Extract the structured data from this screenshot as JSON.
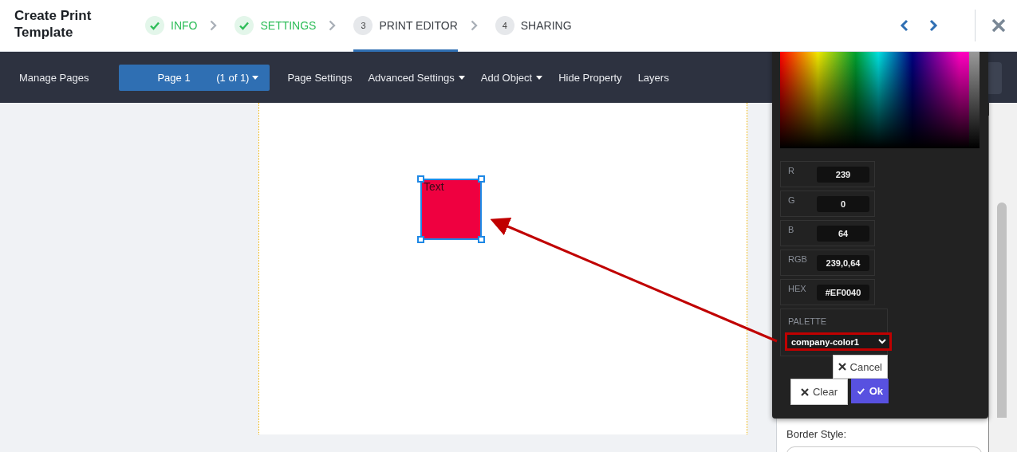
{
  "title": "Create Print Template",
  "steps": [
    {
      "label": "INFO",
      "done": true,
      "selected": false
    },
    {
      "label": "SETTINGS",
      "done": true,
      "selected": false
    },
    {
      "label": "PRINT EDITOR",
      "number": "3",
      "done": false,
      "selected": true
    },
    {
      "label": "SHARING",
      "number": "4",
      "done": false,
      "selected": false
    }
  ],
  "toolbar": {
    "manage_pages": "Manage Pages",
    "page_select": {
      "label": "Page 1",
      "count": "(1 of 1)"
    },
    "items": [
      {
        "label": "Page Settings",
        "dropdown": false
      },
      {
        "label": "Advanced Settings",
        "dropdown": true
      },
      {
        "label": "Add Object",
        "dropdown": true
      },
      {
        "label": "Hide Property",
        "dropdown": false
      },
      {
        "label": "Layers",
        "dropdown": false
      }
    ]
  },
  "canvas": {
    "objects": [
      {
        "kind": "shape",
        "text": "Text",
        "color": "#ef0040",
        "selected": true
      }
    ]
  },
  "color_picker": {
    "channels": [
      {
        "label": "R",
        "value": "239"
      },
      {
        "label": "G",
        "value": "0"
      },
      {
        "label": "B",
        "value": "64"
      },
      {
        "label": "RGB",
        "value": "239,0,64"
      },
      {
        "label": "HEX",
        "value": "#EF0040"
      }
    ],
    "palette": {
      "label": "PALETTE",
      "value": "company-color1",
      "highlighted": true
    },
    "cancel": "Cancel",
    "clear": "Clear",
    "ok": "Ok"
  },
  "side_panel": {
    "label": "Border Style:"
  }
}
